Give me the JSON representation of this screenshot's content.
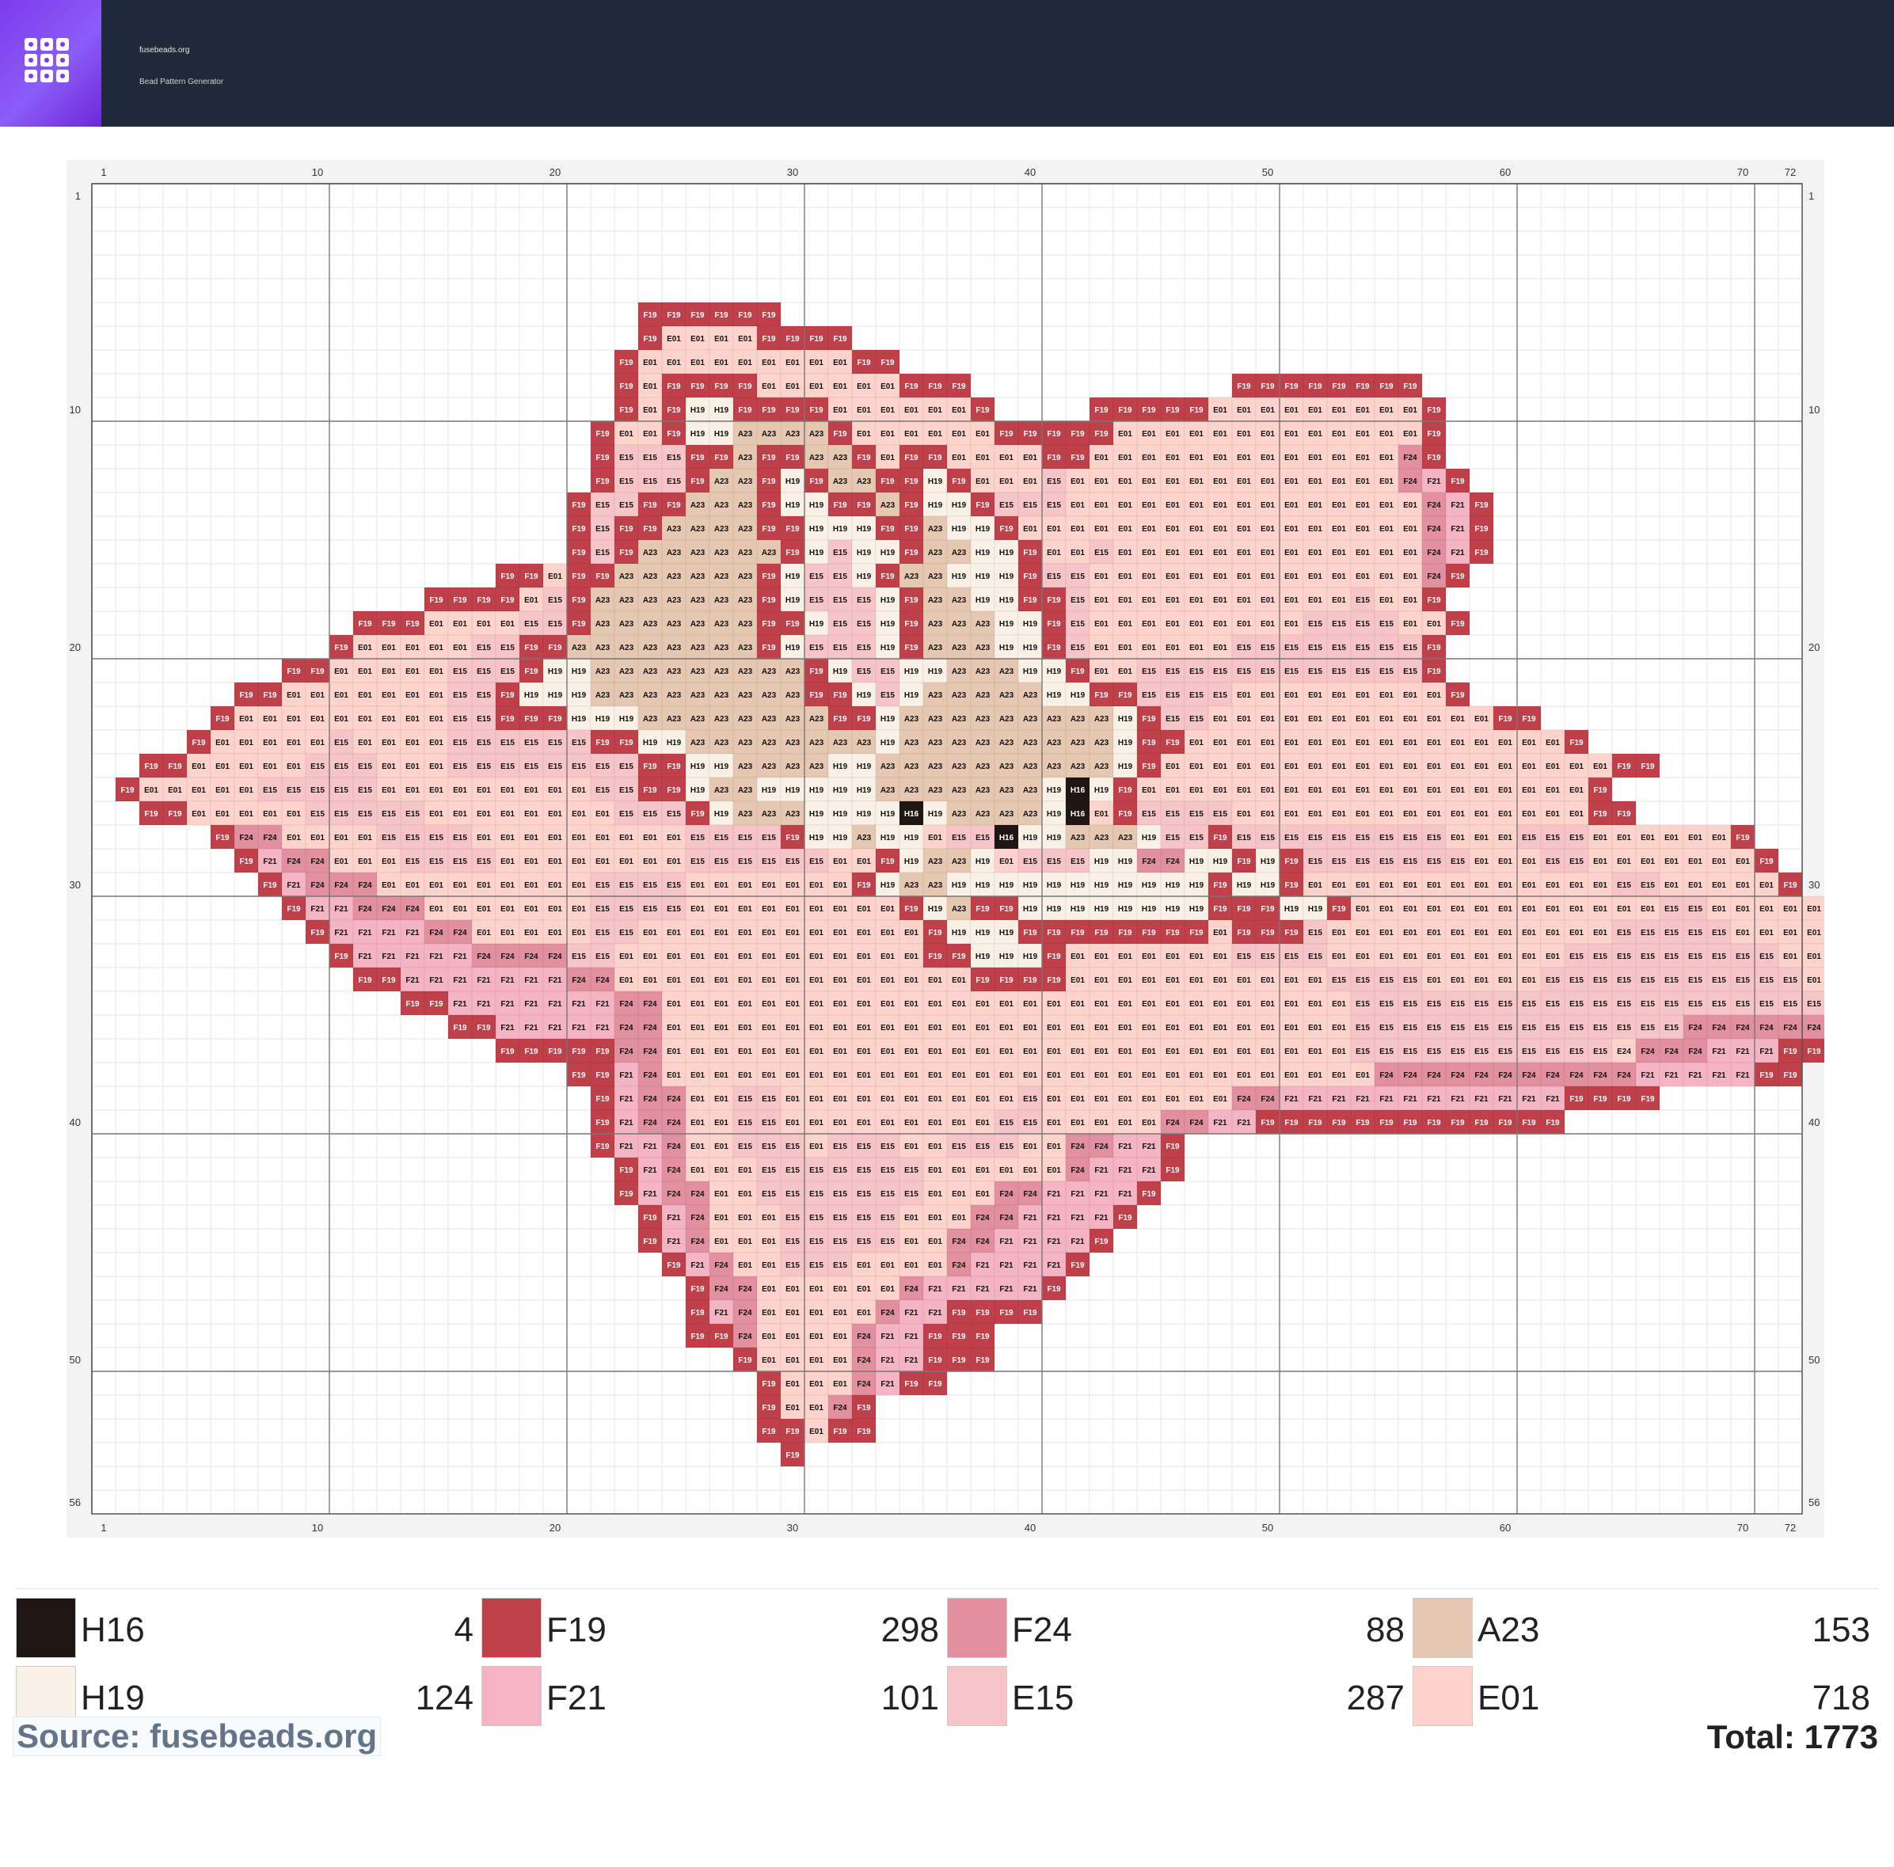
{
  "header": {
    "brand": "fusebeads.org",
    "subtitle": "Bead Pattern Generator",
    "logo_icon": "grid-icon"
  },
  "pattern": {
    "columns": 72,
    "rows": 56,
    "column_labels": [
      1,
      10,
      20,
      30,
      40,
      50,
      60,
      70,
      72
    ],
    "row_labels": [
      1,
      10,
      20,
      30,
      40,
      50,
      56
    ],
    "palette": {
      "H16": "#1f1512",
      "F19": "#c0404a",
      "F24": "#e290a0",
      "A23": "#e6c7b2",
      "H19": "#f9f1e6",
      "F21": "#f5b4c4",
      "E15": "#f7c5c7",
      "E01": "#fdd3cc"
    },
    "rows_data": [
      {
        "r": 6,
        "s": 24,
        "c": "F19 F19 F19 F19 F19 F19"
      },
      {
        "r": 7,
        "s": 24,
        "c": "F19 E01 E01 E01 E01 F19 F19 F19 F19"
      },
      {
        "r": 8,
        "s": 23,
        "c": "F19 E01 E01 E01 E01 E01 E01 E01 E01 E01 F19 F19"
      },
      {
        "r": 9,
        "s": 23,
        "c": "F19 E01 F19 F19 F19 F19 E01 E01 E01 E01 E01 E01 F19 F19 F19"
      },
      {
        "r": 9,
        "s": 49,
        "c": "F19 F19 F19 F19 F19 F19 F19 F19"
      },
      {
        "r": 10,
        "s": 23,
        "c": "F19 E01 F19 H19 H19 F19 F19 F19 F19 E01 E01 E01 E01 E01 E01 F19"
      },
      {
        "r": 10,
        "s": 43,
        "c": "F19 F19 F19 F19 F19 E01 E01 E01 E01 E01 E01 E01 E01 E01 F19"
      },
      {
        "r": 11,
        "s": 22,
        "c": "F19 E01 E01 F19 H19 H19 A23 A23 A23 A23 F19 E01 E01 E01 E01 E01 E01 F19 F19"
      },
      {
        "r": 11,
        "s": 41,
        "c": "F19 F19 F19 E01 E01 E01 E01 E01 E01 E01 E01 E01 E01 E01 E01 E01 F19"
      },
      {
        "r": 12,
        "s": 22,
        "c": "F19 E15 E15 E15 F19 F19 A23 F19 F19 A23 A23 F19 E01 F19 F19 E01 E01 E01 E01 F19 F19 E01 E01 E01 E01 E01 E01 E01 E01 E01 E01 E01 E01 E01 F24 F19"
      },
      {
        "r": 13,
        "s": 22,
        "c": "F19 E15 E15 E15 F19 A23 A23 F19 H19 F19 A23 A23 F19 F19 H19 F19 E01 E01 E01 E15 E01 E01 E01 E01 E01 E01 E01 E01 E01 E01 E01 E01 E01 E01 F24 F21 F19"
      },
      {
        "r": 14,
        "s": 21,
        "c": "F19 E15 E15 F19 F19 A23 A23 A23 F19 H19 H19 F19 F19 A23 F19 H19 H19 F19 E15 E15 E15 E01 E01 E01 E01 E01 E01 E01 E01 E01 E01 E01 E01 E01 E01 E01 F24 F21 F19"
      },
      {
        "r": 15,
        "s": 21,
        "c": "F19 E15 F19 F19 A23 A23 A23 A23 F19 F19 H19 H19 H19 F19 F19 A23 H19 H19 F19 E01 E01 E01 E01 E01 E01 E01 E01 E01 E01 E01 E01 E01 E01 E01 E01 E01 F24 F21 F19"
      },
      {
        "r": 16,
        "s": 21,
        "c": "F19 E15 F19 A23 A23 A23 A23 A23 A23 F19 H19 E15 H19 H19 F19 A23 A23 H19 H19 F19 E01 E01 E15 E01 E01 E01 E01 E01 E01 E01 E01 E01 E01 E01 E01 E01 F24 F21 F19"
      },
      {
        "r": 17,
        "s": 18,
        "c": "F19 F19 E01 F19 F19 A23 A23 A23 A23 A23 A23 F19 H19 E15 E15 H19 F19 A23 A23 H19 H19 H19 F19 E15 E15 E01 E01 E01 E01 E01 E01 E01 E01 E01 E01 E01 E01 E01 E01 F24 F19"
      },
      {
        "r": 18,
        "s": 15,
        "c": "F19 F19 F19 F19 E01 E15 F19 A23 A23 A23 A23 A23 A23 A23 F19 H19 E15 E15 E15 H19 F19 A23 A23 H19 H19 F19 F19 E15 E01 E01 E01 E01 E01 E01 E01 E01 E01 E01 E01 E15 E01 E01 F19"
      },
      {
        "r": 19,
        "s": 12,
        "c": "F19 F19 F19 E01 E01 E01 E01 E15 E15 F19 A23 A23 A23 A23 A23 A23 A23 F19 F19 H19 E15 E15 H19 F19 A23 A23 A23 H19 H19 F19 E15 E01 E01 E01 E01 E01 E01 E01 E01 E01 E15 E15 E15 E15 E01 E01 F19"
      },
      {
        "r": 20,
        "s": 11,
        "c": "F19 E01 E01 E01 E01 E01 E15 E15 F19 F19 A23 A23 A23 A23 A23 A23 A23 A23 F19 H19 E15 E15 E15 H19 F19 A23 A23 A23 H19 H19 F19 E15 E01 E01 E01 E01 E01 E01 E15 E15 E15 E15 E15 E15 E15 E15 F19"
      },
      {
        "r": 21,
        "s": 9,
        "c": "F19 F19 E01 E01 E01 E01 E01 E15 E15 E15 F19 H19 H19 A23 A23 A23 A23 A23 A23 A23 A23 A23 F19 H19 E15 E15 H19 H19 A23 A23 A23 H19 H19 F19 E01 E01 E15 E15 E15 E15 E15 E15 E15 E15 E15 E15 E15 E15 F19"
      },
      {
        "r": 22,
        "s": 7,
        "c": "F19 F19 E01 E01 E01 E01 E01 E01 E01 E15 E15 F19 H19 H19 H19 A23 A23 A23 A23 A23 A23 A23 A23 A23 F19 F19 H19 E15 H19 A23 A23 A23 A23 A23 H19 H19 F19 F19 E15 E15 E15 E15 E01 E01 E01 E01 E01 E01 E01 E01 E01 F19"
      },
      {
        "r": 23,
        "s": 6,
        "c": "F19 E01 E01 E01 E01 E01 E01 E01 E01 E01 E15 E15 F19 F19 F19 H19 H19 H19 A23 A23 A23 A23 A23 A23 A23 A23 F19 F19 H19 A23 A23 A23 A23 A23 A23 A23 A23 A23 H19 F19 E15 E15 E01 E01 E01 E01 E01 E01 E01 E01 E01 E01 E01 E01 F19 F19"
      },
      {
        "r": 24,
        "s": 5,
        "c": "F19 E01 E01 E01 E01 E01 E15 E01 E01 E01 E01 E15 E15 E15 E15 E15 E15 F19 F19 H19 H19 A23 A23 A23 A23 A23 A23 A23 A23 H19 A23 A23 A23 A23 A23 A23 A23 A23 A23 H19 F19 F19 E01 E01 E01 E01 E01 E01 E01 E01 E01 E01 E01 E01 E01 E01 E01 E01 F19"
      },
      {
        "r": 25,
        "s": 3,
        "c": "F19 F19 E01 E01 E01 E01 E01 E15 E15 E15 E01 E01 E01 E15 E15 E15 E15 E15 E15 E15 E15 F19 F19 H19 H19 A23 A23 A23 A23 H19 H19 A23 A23 A23 A23 A23 A23 A23 A23 A23 A23 H19 F19 E01 E01 E01 E01 E01 E01 E01 E01 E01 E01 E01 E01 E01 E01 E01 E01 E01 E01 E01 F19 F19"
      },
      {
        "r": 26,
        "s": 2,
        "c": "F19 E01 E01 E01 E01 E01 E15 E15 E15 E15 E15 E01 E01 E01 E01 E01 E01 E01 E01 E01 E15 E15 F19 F19 H19 A23 A23 H19 H19 H19 H19 H19 A23 A23 A23 A23 A23 A23 A23 H19 H16 H19 F19 E01 E01 E01 E01 E01 E01 E01 E01 E01 E01 E01 E01 E01 E01 E01 E01 E01 E01 E01 F19"
      },
      {
        "r": 27,
        "s": 3,
        "c": "F19 F19 E01 E01 E01 E01 E01 E15 E15 E15 E15 E15 E01 E01 E01 E01 E01 E01 E01 E01 E15 E15 E15 F19 H19 A23 A23 A23 H19 H19 H19 H19 H16 H19 A23 A23 A23 A23 H19 H16 E01 F19 E15 E15 E15 E15 E01 E01 E01 E01 E01 E01 E01 E01 E01 E01 E01 E01 E01 E01 E01 F19 F19"
      },
      {
        "r": 28,
        "s": 6,
        "c": "F19 F24 F24 E01 E01 E01 E01 E15 E15 E15 E15 E01 E01 E01 E01 E01 E01 E01 E01 E01 E15 E15 E15 E15 F19 H19 H19 A23 H19 H19 E01 E15 E15 H16 H19 H19 A23 A23 A23 H19 E15 E15 F19 E15 E15 E15 E15 E15 E15 E15 E15 E15 E01 E01 E01 E15 E15 E15 E01 E01 E01 E01 E01 E01 F19"
      },
      {
        "r": 29,
        "s": 7,
        "c": "F19 F21 F24 F24 E01 E01 E01 E15 E15 E15 E15 E01 E01 E01 E01 E01 E01 E01 E01 E15 E15 E15 E15 E15 E15 E01 E01 F19 H19 A23 A23 H19 E01 E15 E15 E15 H19 H19 F24 F24 H19 H19 F19 H19 F19 E15 E15 E15 E15 E15 E15 E15 E01 E01 E01 E15 E15 E01 E01 E01 E01 E01 E01 E01 F19"
      },
      {
        "r": 30,
        "s": 8,
        "c": "F19 F21 F24 F24 F24 E01 E01 E01 E01 E01 E01 E01 E01 E01 E15 E15 E15 E15 E01 E01 E01 E01 E01 E01 E01 F19 H19 A23 A23 H19 H19 H19 H19 H19 H19 H19 H19 H19 H19 H19 F19 H19 H19 F19 E01 E01 E01 E01 E01 E01 E01 E01 E01 E01 E01 E01 E01 E15 E15 E01 E01 E01 E01 E01 F19"
      },
      {
        "r": 31,
        "s": 9,
        "c": "F19 F21 F21 F24 F24 F24 E01 E01 E01 E01 E01 E01 E01 E15 E15 E15 E15 E01 E01 E01 E01 E01 E01 E01 E01 E01 F19 H19 A23 F19 F19 H19 H19 H19 H19 H19 H19 H19 H19 F19 F19 F19 H19 H19 F19 E01 E01 E01 E01 E01 E01 E01 E01 E01 E01 E01 E01 E01 E15 E15 E01 E01 E01 E01 E01 E01 F19"
      },
      {
        "r": 32,
        "s": 10,
        "c": "F19 F21 F21 F21 F21 F24 F24 E01 E01 E01 E01 E01 E15 E15 E01 E01 E01 E01 E01 E01 E01 E01 E01 E01 E01 E01 F19 H19 H19 H19 F19 F19 F19 F19 F19 F19 F19 F19 E01 F19 F19 F19 E15 E01 E01 E01 E01 E01 E01 E01 E01 E01 E01 E01 E01 E15 E15 E15 E15 E15 E01 E01 E01 E01 E01 F19"
      },
      {
        "r": 33,
        "s": 11,
        "c": "F19 F21 F21 F21 F21 F21 F24 F24 F24 F24 E15 E15 E01 E01 E01 E01 E01 E01 E01 E01 E01 E01 E01 E01 E01 F19 F19 H19 H19 H19 F19 E01 E01 E01 E01 E01 E01 E01 E15 E15 E15 E15 E01 E01 E01 E01 E01 E01 E01 E01 E01 E01 E15 E15 E15 E15 E15 E15 E15 E15 E15 E01 E01 E01 E01 E01 E01 F19"
      },
      {
        "r": 34,
        "s": 12,
        "c": "F19 F19 F21 F21 F21 F21 F21 F21 F21 F24 F24 E01 E01 E01 E01 E01 E01 E01 E01 E01 E01 E01 E01 E01 E01 E01 F19 F19 F19 F19 E01 E01 E01 E01 E01 E01 E01 E01 E01 E01 E01 E15 E15 E15 E15 E01 E01 E01 E01 E01 E15 E15 E15 E15 E15 E15 E15 E15 E15 E15 E15 E01 E01 E01 E01 E01 E01 F19"
      },
      {
        "r": 35,
        "s": 14,
        "c": "F19 F19 F21 F21 F21 F21 F21 F21 F21 F24 F24 E01 E01 E01 E01 E01 E01 E01 E01 E01 E01 E01 E01 E01 E01 E01 E01 E01 E01 E01 E01 E01 E01 E01 E01 E01 E01 E01 E01 E01 E15 E15 E15 E15 E15 E15 E15 E15 E15 E15 E15 E15 E15 E15 E15 E15 E15 E15 E15 E15 E15 E15 E15 E15 E15 F19 F19"
      },
      {
        "r": 36,
        "s": 16,
        "c": "F19 F19 F21 F21 F21 F21 F21 F24 F24 E01 E01 E01 E01 E01 E01 E01 E01 E01 E01 E01 E01 E01 E01 E01 E01 E01 E01 E01 E01 E01 E01 E01 E01 E01 E01 E01 E01 E01 E15 E15 E15 E15 E15 E15 E15 E15 E15 E15 E15 E15 E15 E15 F24 F24 F24 F24 F24 F24 F19 F19"
      },
      {
        "r": 37,
        "s": 18,
        "c": "F19 F19 F19 F19 F19 F24 F24 E01 E01 E01 E01 E01 E01 E01 E01 E01 E01 E01 E01 E01 E01 E01 E01 E01 E01 E01 E01 E01 E01 E01 E01 E01 E01 E01 E01 E01 E15 E15 E15 E15 E15 E15 E15 E15 E15 E15 E15 E24 F24 F24 F24 F21 F21 F21 F19 F19 F19 F19"
      },
      {
        "r": 38,
        "s": 21,
        "c": "F19 F19 F21 F24 E01 E01 E01 E01 E01 E01 E01 E01 E01 E01 E01 E01 E01 E01 E01 E01 E01 E01 E01 E01 E01 E01 E01 E01 E01 E01 E01 E01 E01 E01 F24 F24 F24 F24 F24 F24 F24 F24 F24 F24 F24 F21 F21 F21 F21 F21 F19 F19"
      },
      {
        "r": 39,
        "s": 22,
        "c": "F19 F21 F24 F24 E01 E01 E15 E15 E01 E01 E01 E01 E01 E01 E01 E01 E01 E01 E15 E01 E01 E01 E01 E01 E01 E01 E01 F24 F24 F21 F21 F21 F21 F21 F21 F21 F21 F21 F21 F21 F21 F19 F19 F19 F19"
      },
      {
        "r": 40,
        "s": 22,
        "c": "F19 F21 F24 F24 E01 E01 E15 E15 E01 E01 E01 E01 E01 E01 E01 E01 E01 E15 E15 E01 E01 E01 E01 E01 F24 F24 F21 F21 F19 F19 F19 F19 F19 F19 F19 F19 F19 F19 F19 F19 F19"
      },
      {
        "r": 41,
        "s": 22,
        "c": "F19 F21 F21 F24 E01 E01 E15 E15 E15 E01 E15 E15 E15 E01 E01 E15 E15 E15 E01 E01 F24 F24 F21 F21 F19"
      },
      {
        "r": 42,
        "s": 23,
        "c": "F19 F21 F24 E01 E01 E01 E15 E15 E15 E15 E15 E15 E15 E01 E01 E01 E01 E01 E01 F24 F21 F21 F21 F19"
      },
      {
        "r": 43,
        "s": 23,
        "c": "F19 F21 F24 F24 E01 E01 E15 E15 E15 E15 E15 E15 E15 E01 E01 E01 F24 F24 F21 F21 F21 F21 F19"
      },
      {
        "r": 44,
        "s": 24,
        "c": "F19 F21 F24 E01 E01 E01 E15 E15 E15 E15 E15 E01 E01 E01 F24 F24 F21 F21 F21 F21 F19"
      },
      {
        "r": 45,
        "s": 24,
        "c": "F19 F21 F24 E01 E01 E01 E15 E15 E15 E15 E15 E01 E01 F24 F24 F21 F21 F21 F21 F19"
      },
      {
        "r": 46,
        "s": 25,
        "c": "F19 F21 F24 E01 E01 E15 E15 E15 E01 E01 E01 E01 F24 F21 F21 F21 F21 F19"
      },
      {
        "r": 47,
        "s": 26,
        "c": "F19 F24 F24 E01 E01 E01 E01 E01 E01 F24 F21 F21 F21 F21 F21 F19"
      },
      {
        "r": 48,
        "s": 26,
        "c": "F19 F21 F24 E01 E01 E01 E01 E01 F24 F21 F21 F19 F19 F19 F19"
      },
      {
        "r": 49,
        "s": 26,
        "c": "F19 F19 F24 E01 E01 E01 E01 F24 F21 F21 F19 F19 F19"
      },
      {
        "r": 50,
        "s": 28,
        "c": "F19 E01 E01 E01 E01 F24 F21 F21 F19 F19 F19"
      },
      {
        "r": 51,
        "s": 29,
        "c": "F19 E01 E01 E01 F24 F21 F19 F19"
      },
      {
        "r": 52,
        "s": 29,
        "c": "F19 E01 E01 F24 F19"
      },
      {
        "r": 53,
        "s": 29,
        "c": "F19 F19 E01 F19 F19"
      },
      {
        "r": 54,
        "s": 30,
        "c": "F19"
      }
    ]
  },
  "legend": {
    "items": [
      {
        "code": "H16",
        "count": "4",
        "color": "#1f1512"
      },
      {
        "code": "F19",
        "count": "298",
        "color": "#c0404a"
      },
      {
        "code": "F24",
        "count": "88",
        "color": "#e290a0"
      },
      {
        "code": "A23",
        "count": "153",
        "color": "#e6c7b2"
      },
      {
        "code": "H19",
        "count": "124",
        "color": "#f9f1e6"
      },
      {
        "code": "F21",
        "count": "101",
        "color": "#f5b4c4"
      },
      {
        "code": "E15",
        "count": "287",
        "color": "#f7c5c7"
      },
      {
        "code": "E01",
        "count": "718",
        "color": "#fdd3cc"
      }
    ],
    "source": "Source: fusebeads.org",
    "total": "Total: 1773"
  }
}
